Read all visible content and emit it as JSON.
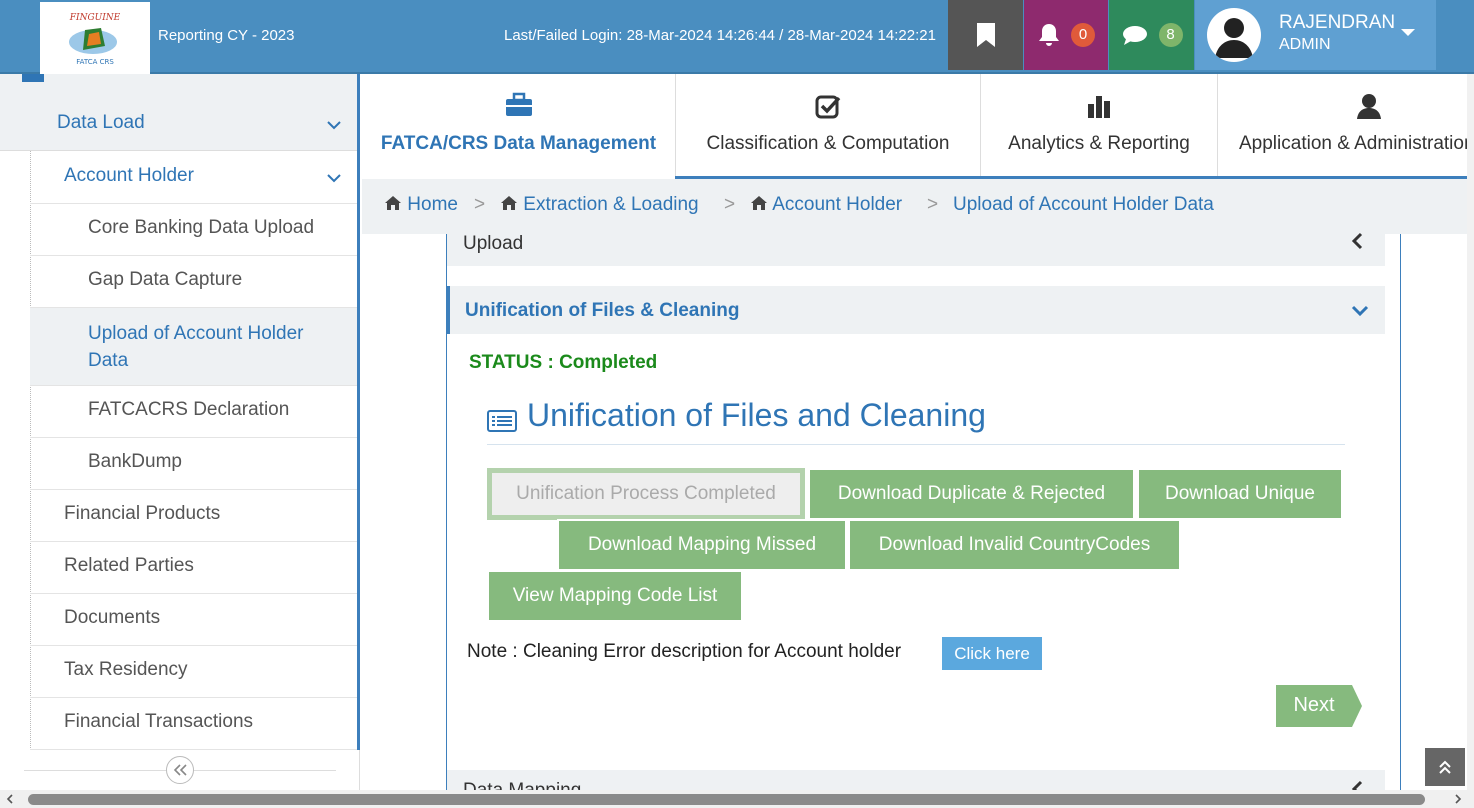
{
  "header": {
    "logo_text": "FINGUINE FATCA CRS",
    "reporting": "Reporting CY - 2023",
    "login_info": "Last/Failed Login: 28-Mar-2024 14:26:44 / 28-Mar-2024 14:22:21",
    "notifications_count": "0",
    "messages_count": "8",
    "user_name": "RAJENDRAN",
    "user_role": "ADMIN"
  },
  "sidebar": {
    "items": [
      {
        "label": "Data Load"
      },
      {
        "label": "Account Holder"
      },
      {
        "label": "Core Banking Data Upload"
      },
      {
        "label": "Gap Data Capture"
      },
      {
        "label": "Upload of Account Holder Data"
      },
      {
        "label": "FATCACRS Declaration"
      },
      {
        "label": "BankDump"
      },
      {
        "label": "Financial Products"
      },
      {
        "label": "Related Parties"
      },
      {
        "label": "Documents"
      },
      {
        "label": "Tax Residency"
      },
      {
        "label": "Financial Transactions"
      }
    ]
  },
  "tabs": [
    {
      "label": "FATCA/CRS Data Management",
      "icon": "briefcase-icon"
    },
    {
      "label": "Classification & Computation",
      "icon": "check-square-icon"
    },
    {
      "label": "Analytics & Reporting",
      "icon": "bar-chart-icon"
    },
    {
      "label": "Application & Administration",
      "icon": "user-icon"
    }
  ],
  "breadcrumb": [
    "Home",
    "Extraction & Loading",
    "Account Holder",
    "Upload of Account Holder Data"
  ],
  "sections": {
    "upload": "Upload",
    "unification": "Unification of Files & Cleaning",
    "next_section": "Data Mapping"
  },
  "status": "STATUS : Completed",
  "heading": "Unification of Files and Cleaning",
  "buttons": {
    "process": "Unification Process Completed",
    "dup": "Download Duplicate & Rejected",
    "unique": "Download Unique",
    "missed": "Download Mapping Missed",
    "invalid": "Download Invalid CountryCodes",
    "viewmap": "View Mapping Code List",
    "click_here": "Click here",
    "next": "Next"
  },
  "note": "Note : Cleaning Error description for Account holder",
  "colors": {
    "header": "#4a8ec0",
    "accent": "#2f75b5",
    "green_button": "#86ba7e",
    "status": "#1b8a1b"
  }
}
